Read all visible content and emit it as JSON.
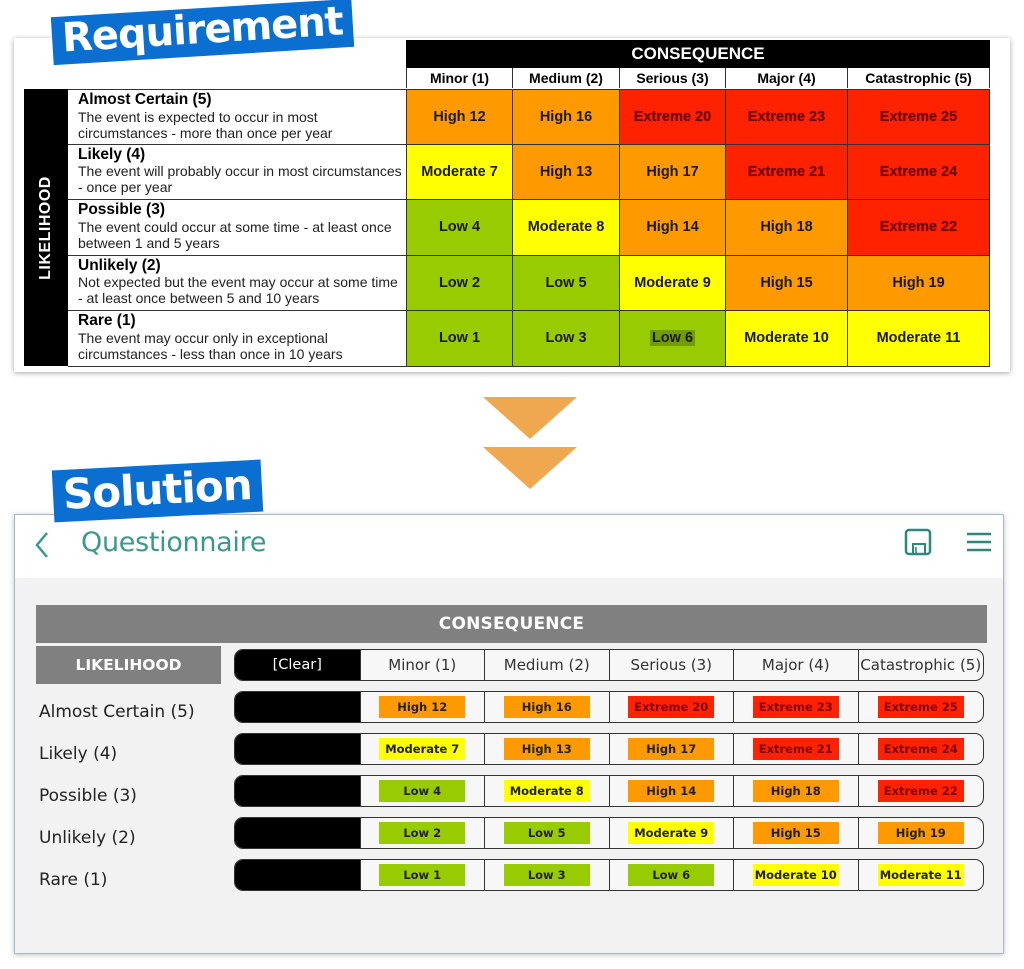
{
  "callouts": {
    "requirement": "Requirement",
    "solution": "Solution"
  },
  "colors": {
    "low": "#99cc00",
    "moderate": "#ffff00",
    "high": "#ff9900",
    "extreme": "#ff2200",
    "callout": "#0a6fd0",
    "arrow": "#f0a850",
    "accent": "#3a9a8a",
    "header_gray": "#808080"
  },
  "requirement": {
    "consequence_label": "CONSEQUENCE",
    "likelihood_label": "LIKELIHOOD",
    "columns": [
      "Minor (1)",
      "Medium (2)",
      "Serious (3)",
      "Major (4)",
      "Catastrophic (5)"
    ],
    "rows": [
      {
        "title": "Almost Certain (5)",
        "description": "The event is expected to occur in most circumstances - more than once per year",
        "cells": [
          {
            "label": "High 12",
            "level": "high"
          },
          {
            "label": "High 16",
            "level": "high"
          },
          {
            "label": "Extreme 20",
            "level": "extreme"
          },
          {
            "label": "Extreme 23",
            "level": "extreme"
          },
          {
            "label": "Extreme 25",
            "level": "extreme"
          }
        ]
      },
      {
        "title": "Likely (4)",
        "description": "The event will probably occur in most circumstances - once per year",
        "cells": [
          {
            "label": "Moderate 7",
            "level": "moderate"
          },
          {
            "label": "High 13",
            "level": "high"
          },
          {
            "label": "High 17",
            "level": "high"
          },
          {
            "label": "Extreme 21",
            "level": "extreme"
          },
          {
            "label": "Extreme 24",
            "level": "extreme"
          }
        ]
      },
      {
        "title": "Possible (3)",
        "description": "The event could occur at some time - at least once between 1 and 5 years",
        "cells": [
          {
            "label": "Low 4",
            "level": "low"
          },
          {
            "label": "Moderate 8",
            "level": "moderate"
          },
          {
            "label": "High 14",
            "level": "high"
          },
          {
            "label": "High 18",
            "level": "high"
          },
          {
            "label": "Extreme 22",
            "level": "extreme"
          }
        ]
      },
      {
        "title": "Unlikely (2)",
        "description": "Not expected but the event may occur at some time - at least once between 5 and 10 years",
        "cells": [
          {
            "label": "Low 2",
            "level": "low"
          },
          {
            "label": "Low 5",
            "level": "low"
          },
          {
            "label": "Moderate 9",
            "level": "moderate"
          },
          {
            "label": "High 15",
            "level": "high"
          },
          {
            "label": "High 19",
            "level": "high"
          }
        ]
      },
      {
        "title": "Rare (1)",
        "description": "The event may occur only in exceptional circumstances - less than once in 10 years",
        "cells": [
          {
            "label": "Low 1",
            "level": "low"
          },
          {
            "label": "Low 3",
            "level": "low"
          },
          {
            "label": "Low 6",
            "level": "low",
            "highlighted": true
          },
          {
            "label": "Moderate 10",
            "level": "moderate"
          },
          {
            "label": "Moderate 11",
            "level": "moderate"
          }
        ]
      }
    ]
  },
  "app": {
    "title": "Questionnaire",
    "icons": {
      "back": "chevron-left-icon",
      "save": "save-icon",
      "menu": "hamburger-menu-icon"
    },
    "consequence_label": "CONSEQUENCE",
    "likelihood_label": "LIKELIHOOD",
    "clear_label": "[Clear]",
    "columns": [
      "Minor (1)",
      "Medium (2)",
      "Serious (3)",
      "Major (4)",
      "Catastrophic (5)"
    ],
    "rows": [
      {
        "label": "Almost Certain (5)",
        "cells": [
          {
            "label": "High 12",
            "level": "high"
          },
          {
            "label": "High 16",
            "level": "high"
          },
          {
            "label": "Extreme 20",
            "level": "extreme"
          },
          {
            "label": "Extreme 23",
            "level": "extreme"
          },
          {
            "label": "Extreme 25",
            "level": "extreme"
          }
        ]
      },
      {
        "label": "Likely (4)",
        "cells": [
          {
            "label": "Moderate 7",
            "level": "moderate"
          },
          {
            "label": "High 13",
            "level": "high"
          },
          {
            "label": "High 17",
            "level": "high"
          },
          {
            "label": "Extreme 21",
            "level": "extreme"
          },
          {
            "label": "Extreme 24",
            "level": "extreme"
          }
        ]
      },
      {
        "label": "Possible (3)",
        "cells": [
          {
            "label": "Low 4",
            "level": "low"
          },
          {
            "label": "Moderate 8",
            "level": "moderate"
          },
          {
            "label": "High 14",
            "level": "high"
          },
          {
            "label": "High 18",
            "level": "high"
          },
          {
            "label": "Extreme 22",
            "level": "extreme"
          }
        ]
      },
      {
        "label": "Unlikely (2)",
        "cells": [
          {
            "label": "Low 2",
            "level": "low"
          },
          {
            "label": "Low 5",
            "level": "low"
          },
          {
            "label": "Moderate 9",
            "level": "moderate"
          },
          {
            "label": "High 15",
            "level": "high"
          },
          {
            "label": "High 19",
            "level": "high"
          }
        ]
      },
      {
        "label": "Rare (1)",
        "cells": [
          {
            "label": "Low 1",
            "level": "low"
          },
          {
            "label": "Low 3",
            "level": "low"
          },
          {
            "label": "Low 6",
            "level": "low"
          },
          {
            "label": "Moderate 10",
            "level": "moderate"
          },
          {
            "label": "Moderate 11",
            "level": "moderate"
          }
        ]
      }
    ]
  }
}
